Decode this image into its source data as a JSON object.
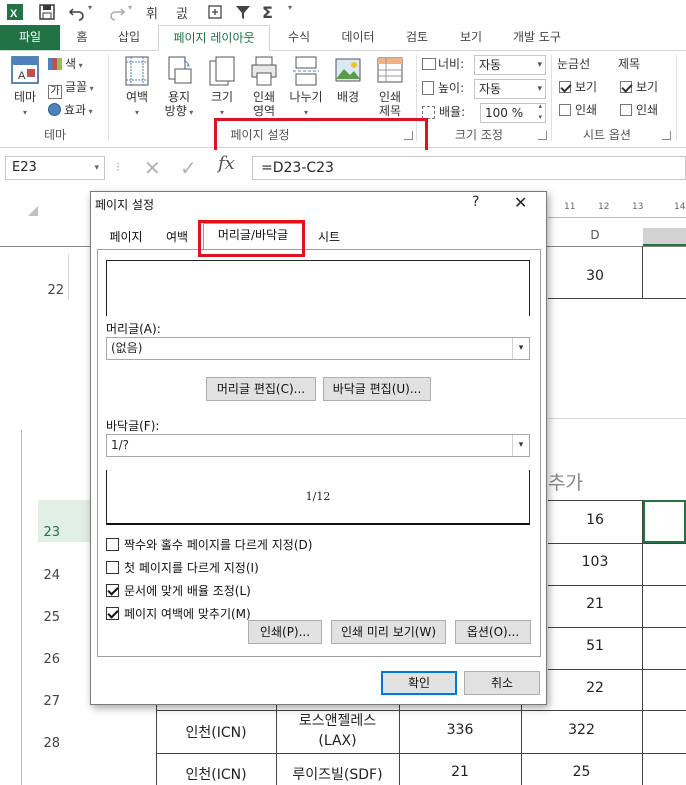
{
  "qat": {
    "undo_label": "",
    "redo_label": ""
  },
  "ribbon_tabs": [
    {
      "label": "파일"
    },
    {
      "label": "홈"
    },
    {
      "label": "삽입"
    },
    {
      "label": "페이지 레이아웃"
    },
    {
      "label": "수식"
    },
    {
      "label": "데이터"
    },
    {
      "label": "검토"
    },
    {
      "label": "보기"
    },
    {
      "label": "개발 도구"
    }
  ],
  "ribbon": {
    "theme": {
      "label": "테마",
      "colors": "색",
      "fonts": "글꼴",
      "effects": "효과",
      "group": "테마"
    },
    "page_setup": {
      "margins": "여백",
      "orientation_1": "용지",
      "orientation_2": "방향",
      "size": "크기",
      "print_area_1": "인쇄",
      "print_area_2": "영역",
      "breaks": "나누기",
      "background": "배경",
      "print_titles_1": "인쇄",
      "print_titles_2": "제목",
      "group": "페이지 설정"
    },
    "scale": {
      "width_label": "너비:",
      "width_value": "자동",
      "height_label": "높이:",
      "height_value": "자동",
      "scale_label": "배율:",
      "scale_value": "100 %",
      "group": "크기 조정"
    },
    "sheet_options": {
      "gridlines": "눈금선",
      "headings": "제목",
      "view": "보기",
      "print": "인쇄",
      "group": "시트 옵션"
    }
  },
  "formula_bar": {
    "name_box": "E23",
    "fx": "fx",
    "formula": "=D23-C23"
  },
  "sheet": {
    "col_d_header": "D",
    "ruler_numbers": [
      "11",
      "12",
      "13",
      "14"
    ],
    "rows": [
      {
        "num": "22",
        "d": "30"
      },
      {
        "num": "23",
        "d": "16"
      },
      {
        "num": "24",
        "d": "103"
      },
      {
        "num": "25",
        "d": "21"
      },
      {
        "num": "26",
        "d": "51"
      },
      {
        "num": "27",
        "d": "22"
      },
      {
        "num": "28",
        "b": "인천(ICN)",
        "c": "로스앤젤레스\n(LAX)",
        "c_line1": "로스앤젤레스",
        "c_line2": "(LAX)",
        "col_c_value": "336",
        "d": "322"
      },
      {
        "num": "",
        "b": "인천(ICN)",
        "c": "루이즈빌(SDF)",
        "col_c_value": "21",
        "d": "25"
      }
    ],
    "partial_text": "추가"
  },
  "dialog": {
    "title": "페이지 설정",
    "help": "?",
    "close": "✕",
    "tabs": [
      {
        "label": "페이지"
      },
      {
        "label": "여백"
      },
      {
        "label": "머리글/바닥글"
      },
      {
        "label": "시트"
      }
    ],
    "header_label": "머리글(A):",
    "header_value": "(없음)",
    "edit_header_button": "머리글 편집(C)...",
    "edit_footer_button": "바닥글 편집(U)...",
    "footer_label": "바닥글(F):",
    "footer_value": "1/?",
    "footer_preview_text": "1/12",
    "options": [
      {
        "label": "짝수와 홀수 페이지를 다르게 지정(D)",
        "checked": false
      },
      {
        "label": "첫 페이지를 다르게 지정(I)",
        "checked": false
      },
      {
        "label": "문서에 맞게 배율 조정(L)",
        "checked": true
      },
      {
        "label": "페이지 여백에 맞추기(M)",
        "checked": true
      }
    ],
    "print_button": "인쇄(P)...",
    "print_preview_button": "인쇄 미리 보기(W)",
    "options_button": "옵션(O)...",
    "ok_button": "확인",
    "cancel_button": "취소"
  },
  "colors": {
    "excel_green": "#217346",
    "highlight_red": "#e2121b"
  }
}
